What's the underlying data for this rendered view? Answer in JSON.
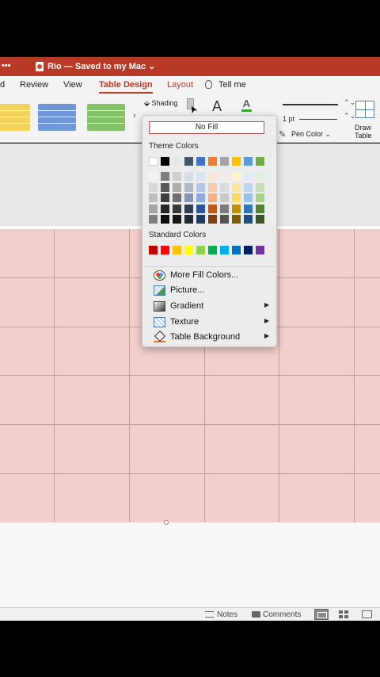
{
  "window": {
    "title": "Rio — Saved to my Mac",
    "title_chevron": "⌄",
    "dots": "•••"
  },
  "tabs": [
    {
      "label": "d"
    },
    {
      "label": "Review"
    },
    {
      "label": "View"
    },
    {
      "label": "Table Design",
      "active": true
    },
    {
      "label": "Layout"
    },
    {
      "label": "Tell me"
    }
  ],
  "ribbon": {
    "gallery_arrow": "›",
    "shading_label": "Shading",
    "line_weight": "1 pt",
    "pen_color_label": "Pen Color",
    "pen_color_chevron": "⌄",
    "draw_table_label": "Draw Table",
    "steppers": "⌃⌄",
    "font_color_chevron": "⌄"
  },
  "shading_menu": {
    "no_fill": "No Fill",
    "theme_heading": "Theme Colors",
    "standard_heading": "Standard Colors",
    "theme_top": [
      "#ffffff",
      "#000000",
      "#e7e6e6",
      "#44546a",
      "#4472c4",
      "#ed7d31",
      "#a5a5a5",
      "#ffc000",
      "#5b9bd5",
      "#70ad47"
    ],
    "theme_shades": [
      [
        "#f2f2f2",
        "#7f7f7f",
        "#d0cece",
        "#d6dce4",
        "#d9e2f3",
        "#fbe5d5",
        "#ededed",
        "#fff2cc",
        "#deebf6",
        "#e2efd9"
      ],
      [
        "#d8d8d8",
        "#595959",
        "#aeabab",
        "#adb9ca",
        "#b4c6e7",
        "#f7cbac",
        "#dbdbdb",
        "#fee599",
        "#bdd7ee",
        "#c5e0b3"
      ],
      [
        "#bfbfbf",
        "#3f3f3f",
        "#757070",
        "#8496b0",
        "#8eaadb",
        "#f4b083",
        "#c9c9c9",
        "#ffd965",
        "#9cc3e5",
        "#a8d08d"
      ],
      [
        "#a5a5a5",
        "#262626",
        "#3a3838",
        "#323f4f",
        "#2f5496",
        "#c45911",
        "#7b7b7b",
        "#bf9000",
        "#2e75b5",
        "#538135"
      ],
      [
        "#7f7f7f",
        "#0c0c0c",
        "#171616",
        "#222a35",
        "#1f3864",
        "#833c0b",
        "#525252",
        "#7f6000",
        "#1e4e79",
        "#375623"
      ]
    ],
    "standard": [
      "#c00000",
      "#ff0000",
      "#ffc000",
      "#ffff00",
      "#92d050",
      "#00b050",
      "#00b0f0",
      "#0070c0",
      "#002060",
      "#7030a0"
    ],
    "items": [
      {
        "label": "More Fill Colors...",
        "icon": "palette-icon",
        "submenu": false
      },
      {
        "label": "Picture...",
        "icon": "picture-icon",
        "submenu": false
      },
      {
        "label": "Gradient",
        "icon": "gradient-icon",
        "submenu": true
      },
      {
        "label": "Texture",
        "icon": "texture-icon",
        "submenu": true
      },
      {
        "label": "Table Background",
        "icon": "bucket-icon",
        "submenu": true
      }
    ],
    "submenu_arrow": "▶"
  },
  "table": {
    "rows": 6,
    "cols": 6,
    "fill": "#f2cecc"
  },
  "statusbar": {
    "notes": "Notes",
    "comments": "Comments"
  },
  "colors": {
    "accent": "#b83a26"
  }
}
